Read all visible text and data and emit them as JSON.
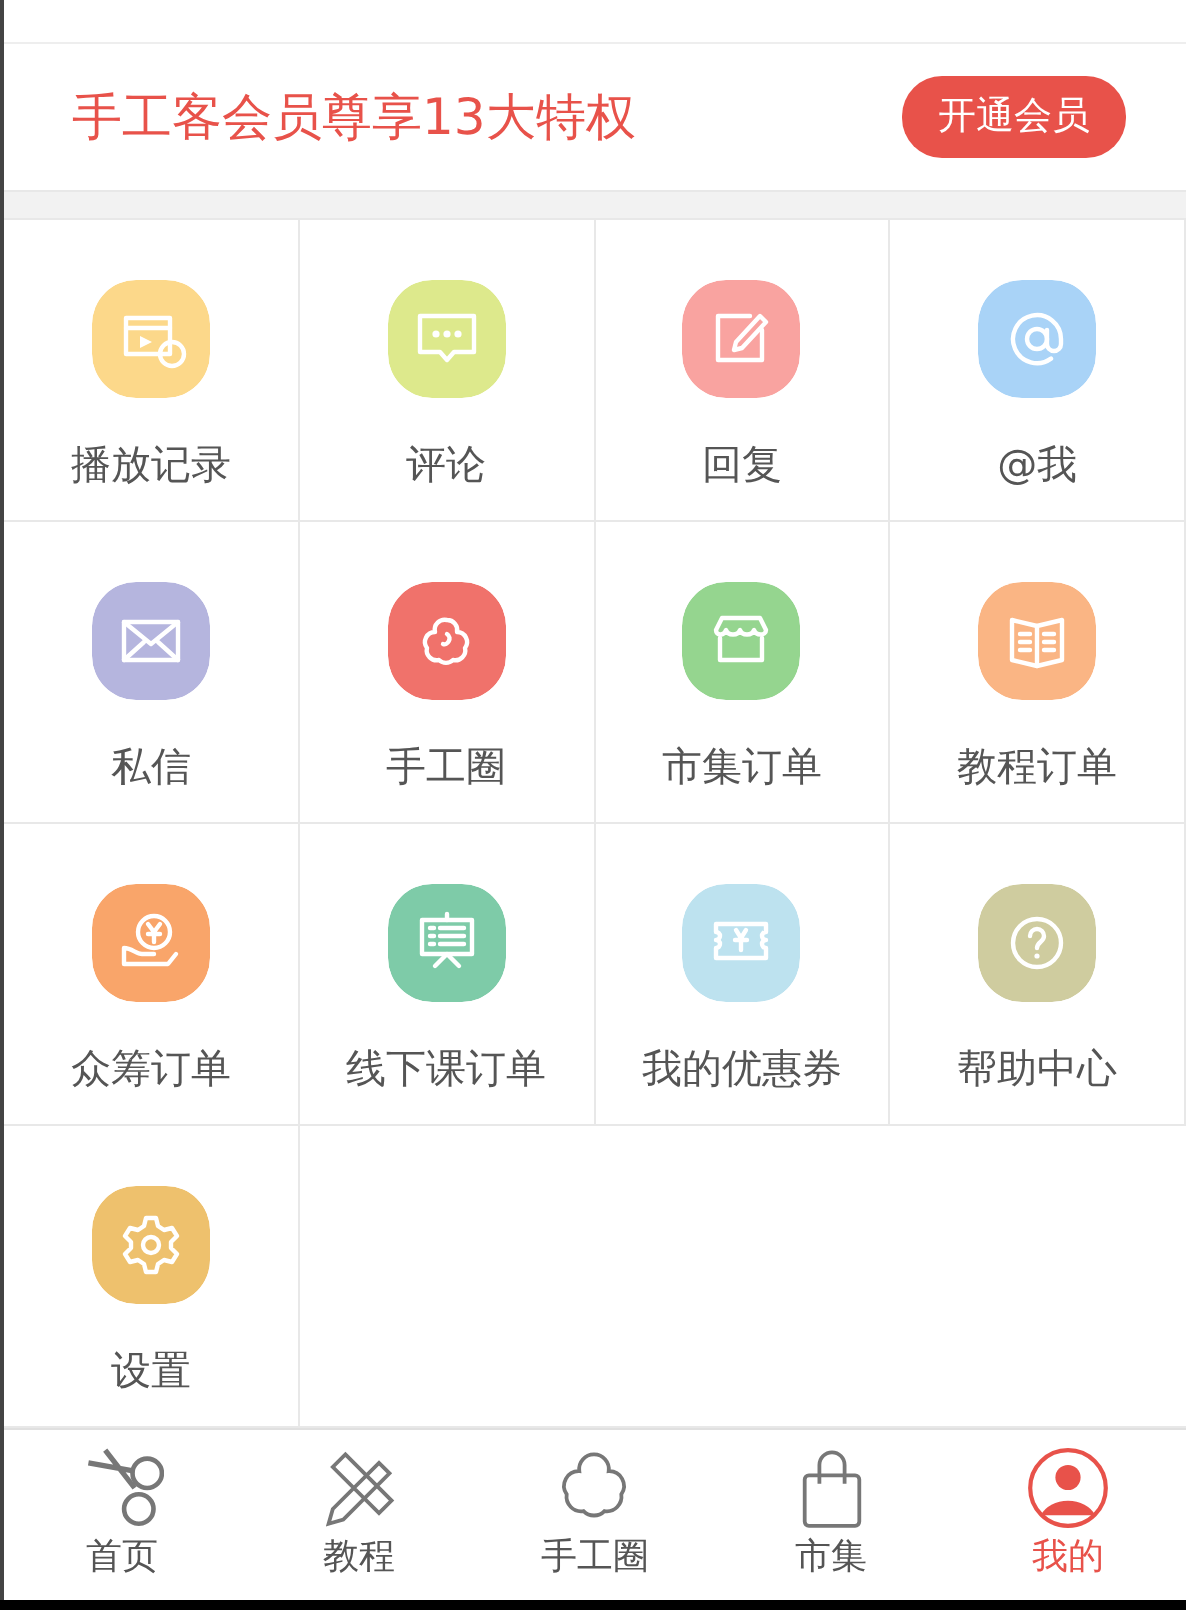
{
  "banner": {
    "text": "手工客会员尊享13大特权",
    "button": "开通会员"
  },
  "grid": [
    {
      "label": "播放记录",
      "kind": "video",
      "color": "#fcd88a"
    },
    {
      "label": "评论",
      "kind": "comment",
      "color": "#dde98c"
    },
    {
      "label": "回复",
      "kind": "edit",
      "color": "#f9a3a0"
    },
    {
      "label": "@我",
      "kind": "at",
      "color": "#a9d3f7"
    },
    {
      "label": "私信",
      "kind": "mail",
      "color": "#b5b5de"
    },
    {
      "label": "手工圈",
      "kind": "flower",
      "color": "#f0726b"
    },
    {
      "label": "市集订单",
      "kind": "shop",
      "color": "#95d58f"
    },
    {
      "label": "教程订单",
      "kind": "book",
      "color": "#fab584"
    },
    {
      "label": "众筹订单",
      "kind": "coin",
      "color": "#f9a56a"
    },
    {
      "label": "线下课订单",
      "kind": "board",
      "color": "#7ecba8"
    },
    {
      "label": "我的优惠券",
      "kind": "ticket",
      "color": "#bde2ef"
    },
    {
      "label": "帮助中心",
      "kind": "help",
      "color": "#cfcc9f"
    },
    {
      "label": "设置",
      "kind": "gear",
      "color": "#eec16d"
    }
  ],
  "tabs": [
    {
      "label": "首页",
      "kind": "scissors",
      "selected": false
    },
    {
      "label": "教程",
      "kind": "pencil",
      "selected": false
    },
    {
      "label": "手工圈",
      "kind": "flower",
      "selected": false
    },
    {
      "label": "市集",
      "kind": "bag",
      "selected": false
    },
    {
      "label": "我的",
      "kind": "person",
      "selected": true
    }
  ]
}
